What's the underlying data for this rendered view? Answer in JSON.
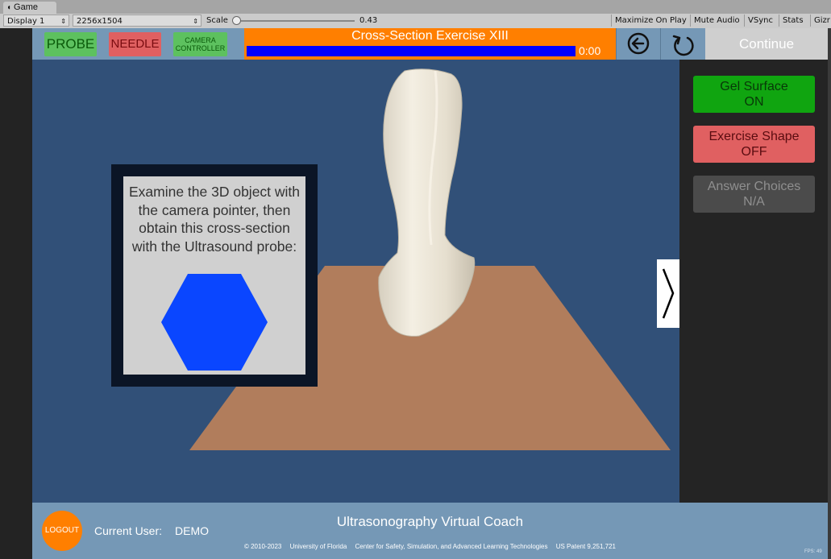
{
  "editor": {
    "tab_label": "Game",
    "display_select": "Display 1",
    "resolution_select": "2256x1504",
    "scale_label": "Scale",
    "scale_value": "0.43",
    "maximize_label": "Maximize On Play",
    "mute_label": "Mute Audio",
    "vsync_label": "VSync",
    "stats_label": "Stats",
    "gizmos_label": "Gizr"
  },
  "hud": {
    "probe_label": "PROBE",
    "needle_label": "NEEDLE",
    "camera_line1": "CAMERA",
    "camera_line2": "CONTROLLER",
    "exercise_title": "Cross-Section Exercise XIII",
    "timer": "0:00",
    "continue_label": "Continue",
    "progress": 1.0
  },
  "side_panel": {
    "gel": {
      "line1": "Gel Surface",
      "line2": "ON"
    },
    "shape": {
      "line1": "Exercise Shape",
      "line2": "OFF"
    },
    "answers": {
      "line1": "Answer Choices",
      "line2": "N/A"
    }
  },
  "instructions": {
    "text": "Examine the 3D object with the camera pointer, then obtain this cross-section with the Ultrasound probe:",
    "target_shape": "hexagon",
    "target_color": "#0a46ff"
  },
  "footer": {
    "logout_label": "LOGOUT",
    "user_label": "Current User:",
    "user_value": "DEMO",
    "app_title": "Ultrasonography Virtual Coach",
    "copyright": "© 2010-2023",
    "university": "University of Florida",
    "center": "Center for Safety, Simulation, and Advanced Learning Technologies",
    "patent": "US Patent 9,251,721",
    "fps": "FPS: 49"
  },
  "colors": {
    "hud_bg": "#7598b6",
    "exercise_bg": "#ff7f00",
    "scene_bg": "#315078",
    "table": "#b17d5c",
    "object": "#ece6d6"
  }
}
